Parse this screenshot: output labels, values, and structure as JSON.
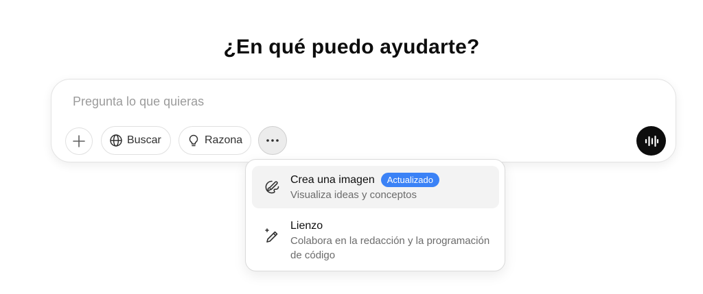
{
  "heading": "¿En qué puedo ayudarte?",
  "composer": {
    "placeholder": "Pregunta lo que quieras",
    "value": "",
    "buttons": {
      "add_icon": "plus-icon",
      "search_label": "Buscar",
      "search_icon": "globe-icon",
      "reason_label": "Razona",
      "reason_icon": "lightbulb-icon",
      "more_icon": "ellipsis-icon",
      "voice_icon": "waveform-icon"
    }
  },
  "tools_menu": {
    "items": [
      {
        "title": "Crea una imagen",
        "badge": "Actualizado",
        "description": "Visualiza ideas y conceptos",
        "icon": "palette-icon",
        "highlighted": true
      },
      {
        "title": "Lienzo",
        "description": "Colabora en la redacción y la programación de código",
        "icon": "pen-sparkle-icon",
        "highlighted": false
      }
    ]
  },
  "colors": {
    "badge": "#3b82f6",
    "voice_button": "#0d0d0d",
    "highlight_row": "#f3f3f3"
  }
}
